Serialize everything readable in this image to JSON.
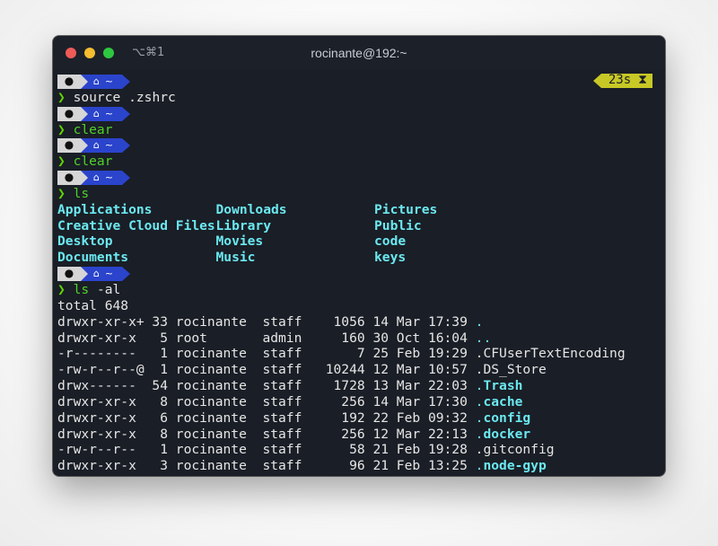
{
  "window": {
    "title": "rocinante@192:~",
    "shortcut": "⌥⌘1"
  },
  "prompt": {
    "os_icon": "",
    "home_icon": "⌂",
    "path": "~",
    "chevron": "❯",
    "timer": "23s",
    "timer_icon": "⧗"
  },
  "colors": {
    "background": "#1a1e26",
    "prompt_os_segment": "#d6d6d6",
    "prompt_dir_segment": "#2b44cc",
    "timer_segment": "#c7c825",
    "valid_command": "#4fd12a",
    "directory": "#6be8f0"
  },
  "commands": [
    {
      "cmd": "source",
      "args": " .zshrc",
      "style": "white"
    },
    {
      "cmd": "clear",
      "args": "",
      "style": "green"
    },
    {
      "cmd": "clear",
      "args": "",
      "style": "green"
    },
    {
      "cmd": "ls",
      "args": "",
      "style": "green"
    },
    {
      "cmd": "ls",
      "args": " -al",
      "style": "green"
    }
  ],
  "ls_output": [
    [
      "Applications",
      "Downloads",
      "Pictures"
    ],
    [
      "Creative Cloud Files",
      "Library",
      "Public"
    ],
    [
      "Desktop",
      "Movies",
      "code"
    ],
    [
      "Documents",
      "Music",
      "keys"
    ]
  ],
  "ls_al": {
    "total": "total 648",
    "rows": [
      {
        "perm": "drwxr-xr-x+",
        "links": "33",
        "owner": "rocinante",
        "group": "staff",
        "size": "1056",
        "day": "14",
        "month": "Mar",
        "time": "17:39",
        "name": ".",
        "is_dir": true
      },
      {
        "perm": "drwxr-xr-x",
        "links": "5",
        "owner": "root",
        "group": "admin",
        "size": "160",
        "day": "30",
        "month": "Oct",
        "time": "16:04",
        "name": "..",
        "is_dir": true
      },
      {
        "perm": "-r--------",
        "links": "1",
        "owner": "rocinante",
        "group": "staff",
        "size": "7",
        "day": "25",
        "month": "Feb",
        "time": "19:29",
        "name": ".CFUserTextEncoding",
        "is_dir": false
      },
      {
        "perm": "-rw-r--r--@",
        "links": "1",
        "owner": "rocinante",
        "group": "staff",
        "size": "10244",
        "day": "12",
        "month": "Mar",
        "time": "10:57",
        "name": ".DS_Store",
        "is_dir": false
      },
      {
        "perm": "drwx------",
        "links": "54",
        "owner": "rocinante",
        "group": "staff",
        "size": "1728",
        "day": "13",
        "month": "Mar",
        "time": "22:03",
        "name": ".Trash",
        "is_dir": true
      },
      {
        "perm": "drwxr-xr-x",
        "links": "8",
        "owner": "rocinante",
        "group": "staff",
        "size": "256",
        "day": "14",
        "month": "Mar",
        "time": "17:30",
        "name": ".cache",
        "is_dir": true
      },
      {
        "perm": "drwxr-xr-x",
        "links": "6",
        "owner": "rocinante",
        "group": "staff",
        "size": "192",
        "day": "22",
        "month": "Feb",
        "time": "09:32",
        "name": ".config",
        "is_dir": true
      },
      {
        "perm": "drwxr-xr-x",
        "links": "8",
        "owner": "rocinante",
        "group": "staff",
        "size": "256",
        "day": "12",
        "month": "Mar",
        "time": "22:13",
        "name": ".docker",
        "is_dir": true
      },
      {
        "perm": "-rw-r--r--",
        "links": "1",
        "owner": "rocinante",
        "group": "staff",
        "size": "58",
        "day": "21",
        "month": "Feb",
        "time": "19:28",
        "name": ".gitconfig",
        "is_dir": false
      },
      {
        "perm": "drwxr-xr-x",
        "links": "3",
        "owner": "rocinante",
        "group": "staff",
        "size": "96",
        "day": "21",
        "month": "Feb",
        "time": "13:25",
        "name": ".node-gyp",
        "is_dir": true
      }
    ]
  }
}
